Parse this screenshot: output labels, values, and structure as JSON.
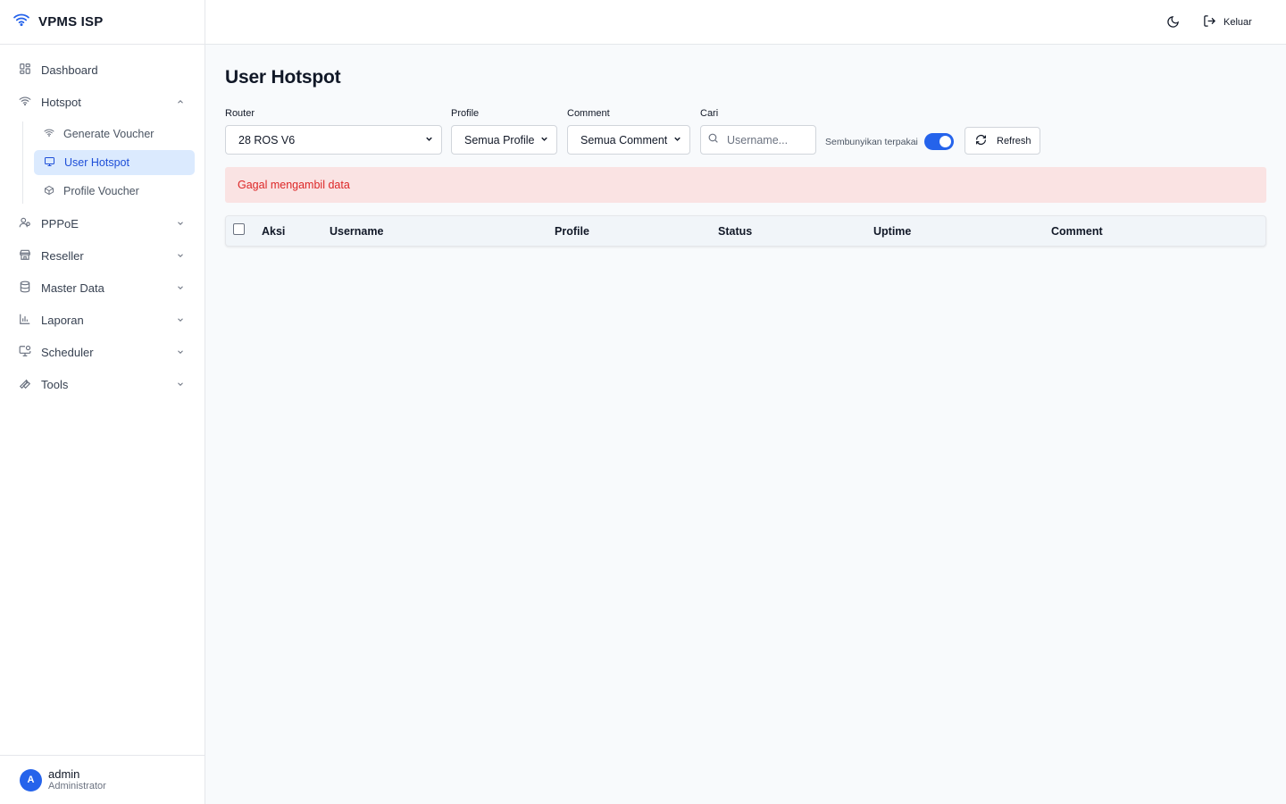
{
  "brand": {
    "title": "VPMS ISP",
    "icon": "wifi-icon",
    "accent": "#2563eb"
  },
  "sidebar": {
    "items": [
      {
        "label": "Dashboard",
        "icon": "grid-icon"
      },
      {
        "label": "Hotspot",
        "icon": "wifi-icon",
        "expanded": true,
        "children": [
          {
            "label": "Generate Voucher",
            "icon": "wifi-icon"
          },
          {
            "label": "User Hotspot",
            "icon": "monitor-icon",
            "active": true
          },
          {
            "label": "Profile Voucher",
            "icon": "box-icon"
          }
        ]
      },
      {
        "label": "PPPoE",
        "icon": "users-icon"
      },
      {
        "label": "Reseller",
        "icon": "store-icon"
      },
      {
        "label": "Master Data",
        "icon": "database-icon"
      },
      {
        "label": "Laporan",
        "icon": "bar-chart-icon"
      },
      {
        "label": "Scheduler",
        "icon": "monitor-clock-icon"
      },
      {
        "label": "Tools",
        "icon": "wrench-icon"
      }
    ]
  },
  "user": {
    "initial": "A",
    "name": "admin",
    "role": "Administrator"
  },
  "header": {
    "logout_label": "Keluar"
  },
  "main": {
    "title": "User Hotspot",
    "filters": {
      "router": {
        "label": "Router",
        "value": "28 ROS V6"
      },
      "profile": {
        "label": "Profile",
        "value": "Semua Profile"
      },
      "comment": {
        "label": "Comment",
        "value": "Semua Comment"
      },
      "search": {
        "label": "Cari",
        "placeholder": "Username..."
      }
    },
    "hide_used": {
      "label": "Sembunyikan terpakai",
      "on": true
    },
    "refresh_label": "Refresh",
    "error_message": "Gagal mengambil data",
    "error_bg": "#fae3e3",
    "error_color": "#dc2626",
    "table": {
      "columns": [
        "Aksi",
        "Username",
        "Profile",
        "Status",
        "Uptime",
        "Comment"
      ],
      "rows": []
    }
  }
}
